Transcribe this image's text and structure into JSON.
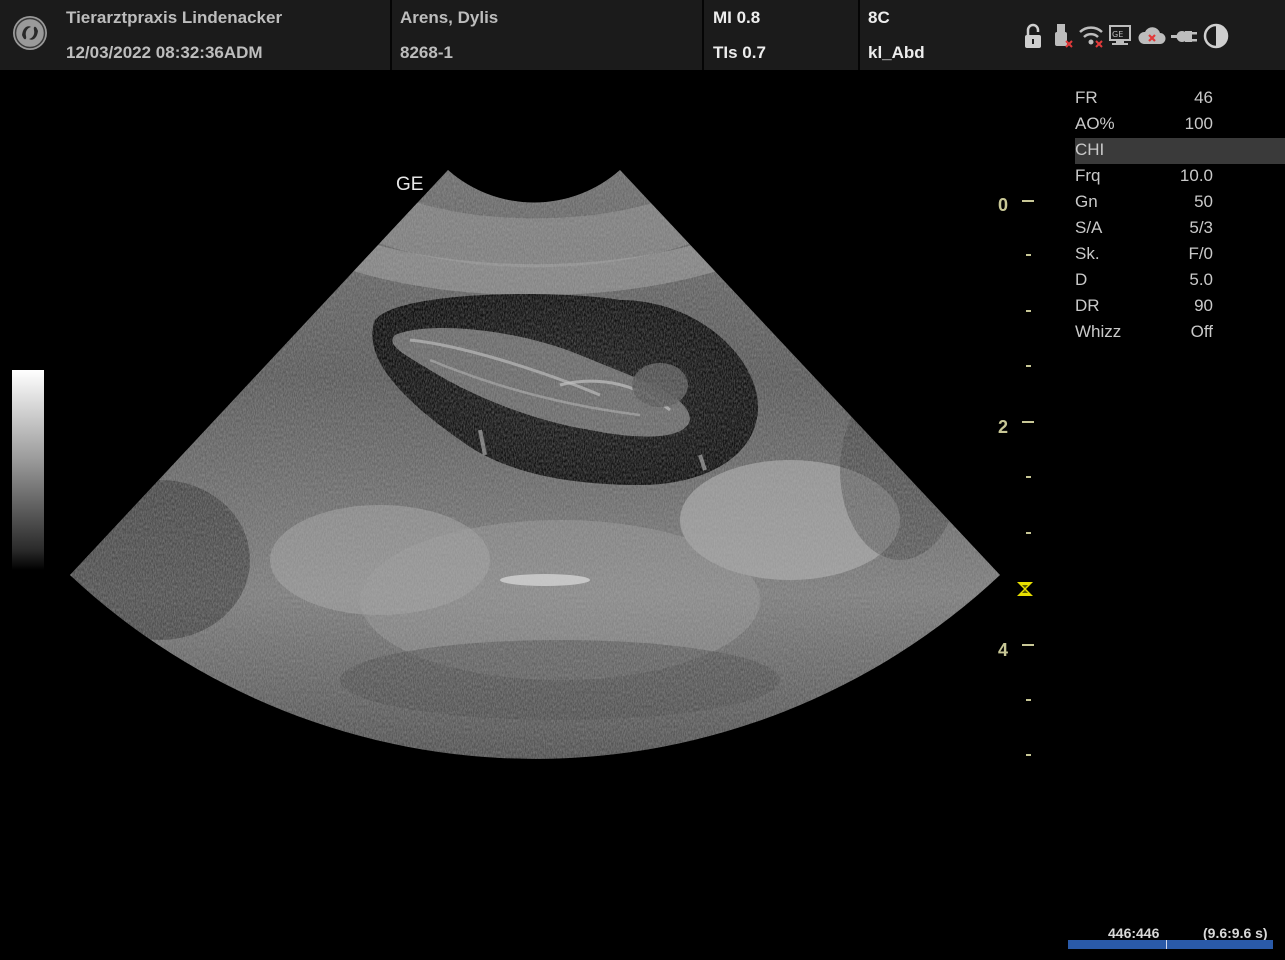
{
  "header": {
    "clinic": "Tierarztpraxis Lindenacker",
    "datetime": "12/03/2022 08:32:36ADM",
    "patient_name": "Arens, Dylis",
    "patient_id": "8268-1",
    "mi": "MI 0.8",
    "tis": "TIs 0.7",
    "probe": "8C",
    "preset": "kl_Abd"
  },
  "status_icons": [
    "lock-icon",
    "usb-disconnected-icon",
    "wifi-disconnected-icon",
    "network-disconnected-icon",
    "cloud-disconnected-icon",
    "power-plug-icon",
    "brightness-icon"
  ],
  "image": {
    "orientation_label": "GE"
  },
  "depth_scale": {
    "labels": [
      "0",
      "2",
      "4"
    ],
    "focus_depth_cm": 3.3
  },
  "params": [
    {
      "label": "FR",
      "value": "46"
    },
    {
      "label": "AO%",
      "value": "100"
    },
    {
      "label": "CHI",
      "value": "",
      "highlight": true
    },
    {
      "label": "Frq",
      "value": "10.0"
    },
    {
      "label": "Gn",
      "value": "50"
    },
    {
      "label": "S/A",
      "value": "5/3"
    },
    {
      "label": "Sk.",
      "value": "F/0"
    },
    {
      "label": "D",
      "value": "5.0"
    },
    {
      "label": "DR",
      "value": "90"
    },
    {
      "label": "Whizz",
      "value": "Off"
    }
  ],
  "cine": {
    "frames": "446:446",
    "time": "(9.6:9.6 s)"
  },
  "colors": {
    "header_bg": "#1b1b1b",
    "depth_scale": "#c8c796",
    "focus_marker": "#e8e000",
    "cine_bar": "#2a5aa8"
  }
}
